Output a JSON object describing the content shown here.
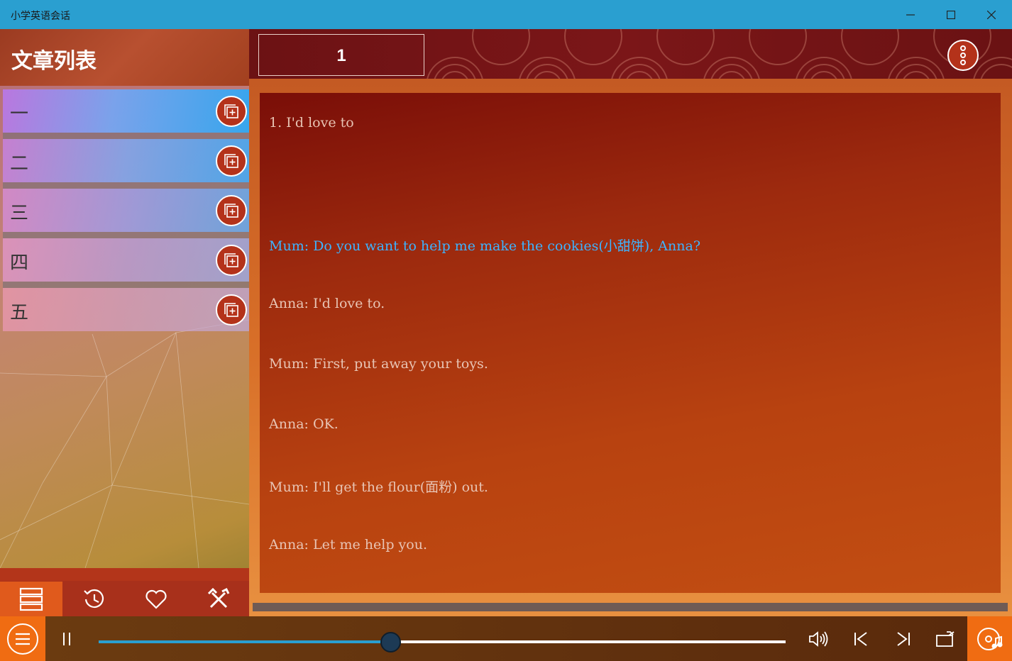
{
  "window": {
    "title": "小学英语会话",
    "minimize_icon": "minimize-icon",
    "maximize_icon": "maximize-icon",
    "close_icon": "close-icon"
  },
  "sidebar": {
    "title": "文章列表",
    "chapters": [
      {
        "label": "一",
        "action_icon": "add-to-playlist-icon"
      },
      {
        "label": "二",
        "action_icon": "add-to-playlist-icon"
      },
      {
        "label": "三",
        "action_icon": "add-to-playlist-icon"
      },
      {
        "label": "四",
        "action_icon": "add-to-playlist-icon"
      },
      {
        "label": "五",
        "action_icon": "add-to-playlist-icon"
      }
    ],
    "tabs": [
      {
        "name": "list-icon",
        "active": true
      },
      {
        "name": "history-icon",
        "active": false
      },
      {
        "name": "heart-icon",
        "active": false
      },
      {
        "name": "tools-icon",
        "active": false
      }
    ]
  },
  "header": {
    "page_number": "1",
    "menu_icon": "more-vertical-icon"
  },
  "article": {
    "lines": [
      {
        "text": "1. I'd love to",
        "highlight": false
      },
      {
        "text": "Mum: Do you want to help me make the cookies(小甜饼), Anna?",
        "highlight": true
      },
      {
        "text": "Anna: I'd love to.",
        "highlight": false
      },
      {
        "text": "Mum: First, put away your toys.",
        "highlight": false
      },
      {
        "text": "Anna: OK.",
        "highlight": false
      },
      {
        "text": "Mum: I'll get the flour(面粉) out.",
        "highlight": false
      },
      {
        "text": "Anna: Let me help you.",
        "highlight": false
      }
    ]
  },
  "player": {
    "progress": 0.425,
    "buttons": [
      "menu-icon",
      "pause-icon",
      "volume-icon",
      "previous-icon",
      "next-icon",
      "repeat-icon",
      "music-disc-icon"
    ],
    "colors": {
      "accent": "#f06c12",
      "progress": "#2a9fd0"
    }
  }
}
